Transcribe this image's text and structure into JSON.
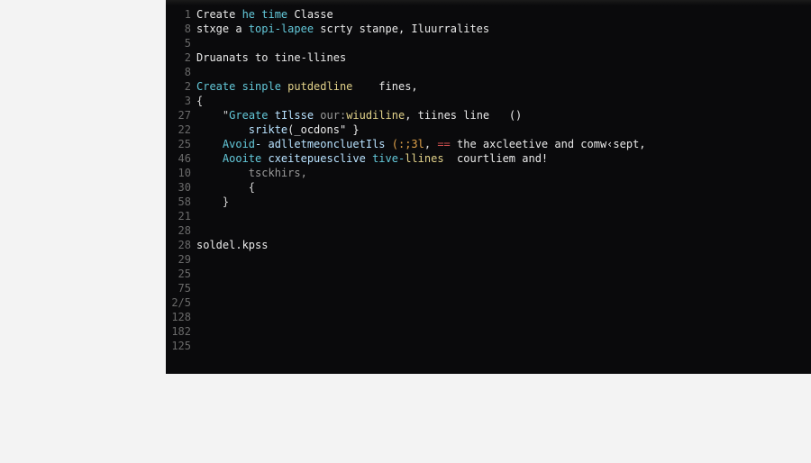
{
  "editor": {
    "gutter": [
      "1",
      "8",
      "5",
      "2",
      "8",
      "2",
      "3",
      "27",
      "22",
      "25",
      "46",
      "10",
      "30",
      "58",
      "21",
      "28",
      "28",
      "29",
      "25",
      "75",
      "2/5",
      "128",
      "182",
      "125",
      ""
    ],
    "lines": [
      {
        "indent": 0,
        "tokens": [
          {
            "t": "Create ",
            "c": "tk-white"
          },
          {
            "t": "he time",
            "c": "tk-kw"
          },
          {
            "t": " Classe",
            "c": "tk-white"
          }
        ]
      },
      {
        "indent": 0,
        "tokens": [
          {
            "t": "stxge a ",
            "c": "tk-white"
          },
          {
            "t": "topi-lapee ",
            "c": "tk-kw"
          },
          {
            "t": "scrty stanpe, Iluurralites",
            "c": "tk-white"
          }
        ]
      },
      {
        "indent": 0,
        "tokens": []
      },
      {
        "indent": 0,
        "tokens": [
          {
            "t": "Druanats to tine-llines",
            "c": "tk-white"
          }
        ]
      },
      {
        "indent": 0,
        "tokens": []
      },
      {
        "indent": 0,
        "tokens": [
          {
            "t": "Create sinple ",
            "c": "tk-kw"
          },
          {
            "t": "putdedline",
            "c": "tk-id"
          },
          {
            "t": "    fines,",
            "c": "tk-white"
          }
        ]
      },
      {
        "indent": 0,
        "tokens": [
          {
            "t": "{",
            "c": "tk-punc"
          }
        ]
      },
      {
        "indent": 2,
        "tokens": [
          {
            "t": "\"",
            "c": "tk-punc"
          },
          {
            "t": "Greate",
            "c": "tk-kw"
          },
          {
            "t": " tIlsse ",
            "c": "tk-type"
          },
          {
            "t": "our:",
            "c": "tk-dim"
          },
          {
            "t": "wiudiline",
            "c": "tk-id"
          },
          {
            "t": ", tiines line   ()",
            "c": "tk-white"
          }
        ]
      },
      {
        "indent": 4,
        "tokens": [
          {
            "t": "srikte",
            "c": "tk-type"
          },
          {
            "t": "(_ocdons\" }",
            "c": "tk-white"
          }
        ]
      },
      {
        "indent": 2,
        "tokens": [
          {
            "t": "Avoid",
            "c": "tk-kw"
          },
          {
            "t": "- adlletmeoncluetIls ",
            "c": "tk-type"
          },
          {
            "t": "(:;3l",
            "c": "tk-lit"
          },
          {
            "t": ", ",
            "c": "tk-white"
          },
          {
            "t": "==",
            "c": "tk-op"
          },
          {
            "t": " the axcleetive and comw‹sept,",
            "c": "tk-white"
          }
        ]
      },
      {
        "indent": 2,
        "tokens": [
          {
            "t": "Aooite ",
            "c": "tk-kw"
          },
          {
            "t": "cxeitepuesclive ",
            "c": "tk-type"
          },
          {
            "t": "tive-",
            "c": "tk-kw"
          },
          {
            "t": "llines",
            "c": "tk-id"
          },
          {
            "t": "  courtliem and!",
            "c": "tk-white"
          }
        ]
      },
      {
        "indent": 4,
        "tokens": [
          {
            "t": "tsckhirs,",
            "c": "tk-dim"
          }
        ]
      },
      {
        "indent": 4,
        "tokens": [
          {
            "t": "{",
            "c": "tk-punc"
          }
        ]
      },
      {
        "indent": 2,
        "tokens": [
          {
            "t": "}",
            "c": "tk-punc"
          }
        ]
      },
      {
        "indent": 0,
        "tokens": []
      },
      {
        "indent": 0,
        "tokens": []
      },
      {
        "indent": 0,
        "tokens": [
          {
            "t": "soldel.kpss",
            "c": "tk-white"
          }
        ]
      },
      {
        "indent": 0,
        "tokens": []
      },
      {
        "indent": 0,
        "tokens": []
      },
      {
        "indent": 0,
        "tokens": []
      },
      {
        "indent": 0,
        "tokens": []
      },
      {
        "indent": 0,
        "tokens": []
      },
      {
        "indent": 0,
        "tokens": []
      },
      {
        "indent": 0,
        "tokens": []
      },
      {
        "indent": 0,
        "tokens": []
      }
    ]
  }
}
